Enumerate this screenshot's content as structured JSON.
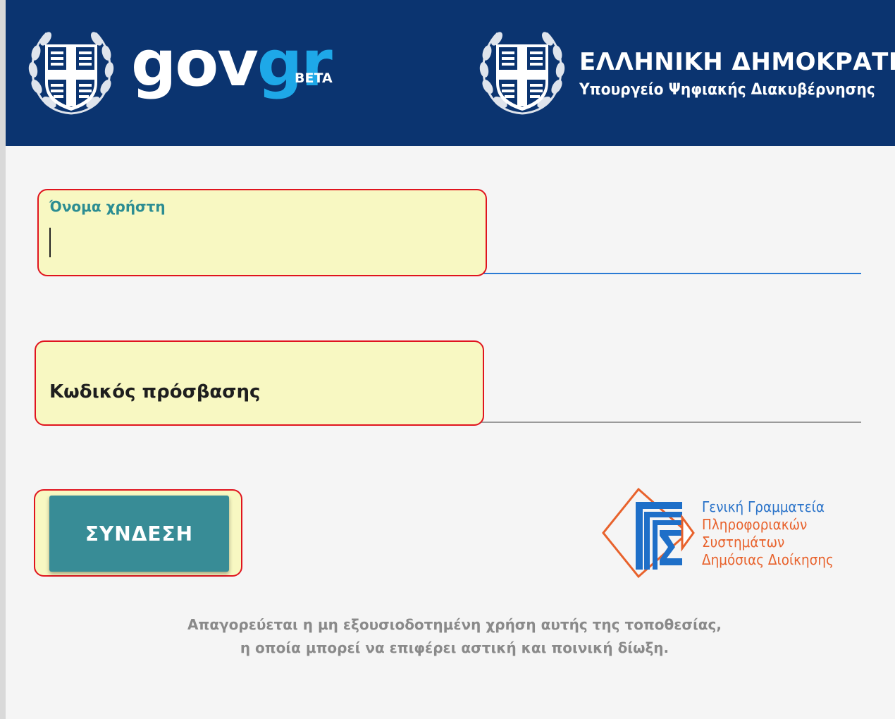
{
  "header": {
    "brand_gov": "gov",
    "brand_gr": "gr",
    "brand_beta": "BETA",
    "republic_title": "ΕΛΛΗΝΙΚΗ ΔΗΜΟΚΡΑΤΙΑ",
    "ministry": "Υπουργείο Ψηφιακής Διακυβέρνησης",
    "colors": {
      "background": "#0b3470",
      "accent": "#1ea8e8"
    }
  },
  "form": {
    "username": {
      "label": "Όνομα χρήστη",
      "value": ""
    },
    "password": {
      "label": "Κωδικός πρόσβασης",
      "value": ""
    },
    "login_button": "ΣΥΝΔΕΣΗ",
    "colors": {
      "field_highlight": "#f8f8c2",
      "outline": "#e0141e",
      "button": "#388c96",
      "active_underline": "#2a7bd4"
    }
  },
  "gsis": {
    "lines": [
      "Γενική Γραμματεία",
      "Πληροφοριακών",
      "Συστημάτων",
      "Δημόσιας Διοίκησης"
    ],
    "colors": {
      "blue": "#2a73c9",
      "orange": "#e8622c"
    }
  },
  "footer": {
    "warning_line1": "Απαγορεύεται η μη εξουσιοδοτημένη χρήση αυτής της τοποθεσίας,",
    "warning_line2": "η οποία μπορεί να επιφέρει αστική και ποινική δίωξη."
  }
}
